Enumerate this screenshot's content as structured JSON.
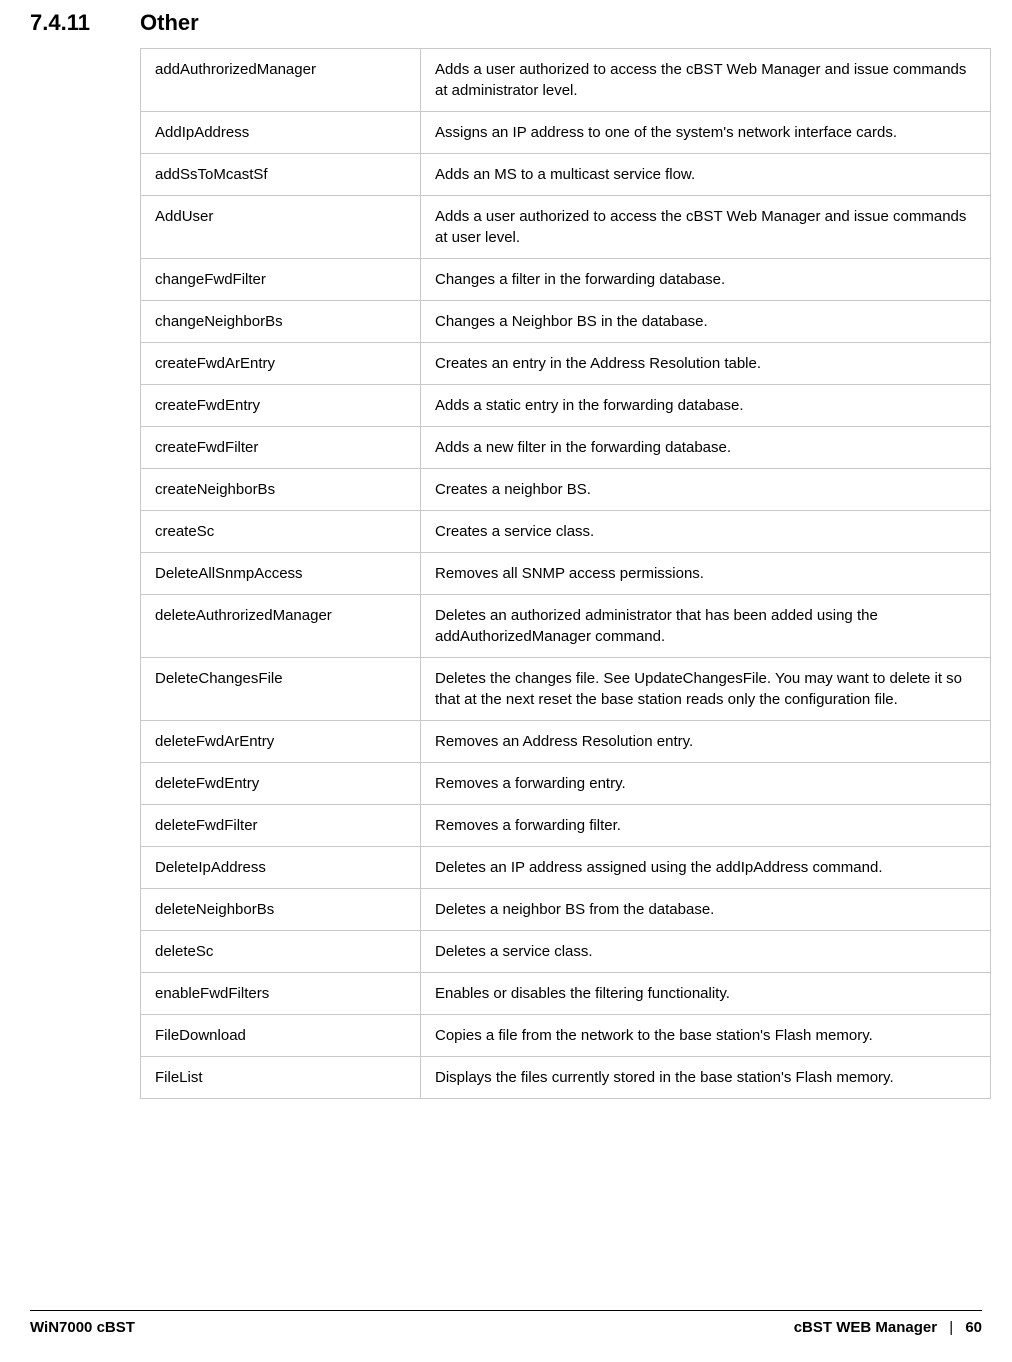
{
  "header": {
    "section_number": "7.4.11",
    "section_title": "Other"
  },
  "table": {
    "rows": [
      {
        "name": "addAuthrorizedManager",
        "desc": "Adds a user authorized to access the cBST Web Manager and issue commands at administrator level."
      },
      {
        "name": "AddIpAddress",
        "desc": "Assigns an IP address to one of the system's network interface cards."
      },
      {
        "name": "addSsToMcastSf",
        "desc": "Adds an MS to a multicast service flow."
      },
      {
        "name": "AddUser",
        "desc": "Adds a user authorized to access the cBST Web Manager and issue commands at user level."
      },
      {
        "name": "changeFwdFilter",
        "desc": "Changes a filter in the forwarding database."
      },
      {
        "name": "changeNeighborBs",
        "desc": "Changes a Neighbor BS in the database."
      },
      {
        "name": "createFwdArEntry",
        "desc": "Creates an entry in the Address Resolution table."
      },
      {
        "name": "createFwdEntry",
        "desc": "Adds a static entry in the forwarding database."
      },
      {
        "name": "createFwdFilter",
        "desc": "Adds a new filter in the forwarding database."
      },
      {
        "name": "createNeighborBs",
        "desc": "Creates a neighbor BS."
      },
      {
        "name": "createSc",
        "desc": "Creates a service class."
      },
      {
        "name": "DeleteAllSnmpAccess",
        "desc": "Removes all SNMP access permissions."
      },
      {
        "name": "deleteAuthrorizedManager",
        "desc": "Deletes an authorized administrator that has been added using the addAuthorizedManager command."
      },
      {
        "name": "DeleteChangesFile",
        "desc": "Deletes the changes file. See UpdateChangesFile. You may want to delete it so that at the next reset the base station reads only the configuration file."
      },
      {
        "name": "deleteFwdArEntry",
        "desc": "Removes an Address Resolution entry."
      },
      {
        "name": "deleteFwdEntry",
        "desc": "Removes a forwarding entry."
      },
      {
        "name": "deleteFwdFilter",
        "desc": "Removes a forwarding filter."
      },
      {
        "name": "DeleteIpAddress",
        "desc": "Deletes an IP address assigned using the addIpAddress command."
      },
      {
        "name": "deleteNeighborBs",
        "desc": "Deletes a neighbor BS from the database."
      },
      {
        "name": "deleteSc",
        "desc": "Deletes a service class."
      },
      {
        "name": "enableFwdFilters",
        "desc": "Enables or disables the filtering functionality."
      },
      {
        "name": "FileDownload",
        "desc": "Copies a file from the network to the base station's Flash memory."
      },
      {
        "name": "FileList",
        "desc": "Displays the files currently stored in the base station's Flash memory."
      }
    ]
  },
  "footer": {
    "left": "WiN7000 cBST",
    "right_label": "cBST WEB Manager",
    "separator": "|",
    "page_number": "60"
  }
}
